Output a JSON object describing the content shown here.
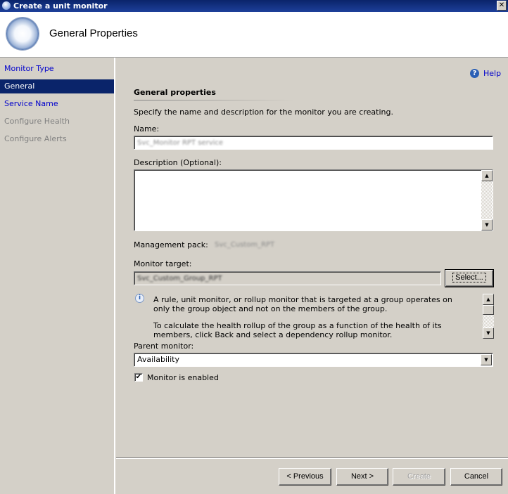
{
  "window": {
    "title": "Create a unit monitor",
    "close_glyph": "✕"
  },
  "header": {
    "title": "General Properties",
    "icon": "monitor-orb-icon"
  },
  "sidebar": {
    "items": [
      {
        "label": "Monitor Type",
        "state": "link"
      },
      {
        "label": "General",
        "state": "selected"
      },
      {
        "label": "Service Name",
        "state": "link"
      },
      {
        "label": "Configure Health",
        "state": "disabled"
      },
      {
        "label": "Configure Alerts",
        "state": "disabled"
      }
    ]
  },
  "help": {
    "icon_glyph": "?",
    "label": "Help"
  },
  "section": {
    "title": "General properties",
    "intro": "Specify the name and description for the monitor you are creating."
  },
  "fields": {
    "name_label": "Name:",
    "name_value": "Svc_Monitor RPT service",
    "description_label": "Description (Optional):",
    "description_value": "",
    "management_pack_label": "Management pack:",
    "management_pack_value": "Svc_Custom_RPT",
    "monitor_target_label": "Monitor target:",
    "monitor_target_value": "Svc_Custom_Group_RPT",
    "select_button": "Select...",
    "parent_monitor_label": "Parent monitor:",
    "parent_monitor_value": "Availability",
    "enabled_label": "Monitor is enabled",
    "enabled_checked": true,
    "check_glyph": "✔"
  },
  "info": {
    "icon_glyph": "i",
    "text_1": "A rule, unit monitor, or rollup monitor that is targeted at a group operates on only the group object and not on the members of the group.",
    "text_2": "To calculate the health rollup of the group as a function of the health of its members, click Back and select a dependency rollup monitor."
  },
  "scroll": {
    "up_glyph": "▲",
    "down_glyph": "▼"
  },
  "footer": {
    "previous": "< Previous",
    "next": "Next >",
    "create": "Create",
    "cancel": "Cancel"
  },
  "colors": {
    "selection": "#0a246a",
    "link": "#0000cc",
    "titlebar": "#0a246a",
    "face": "#d4d0c8"
  }
}
